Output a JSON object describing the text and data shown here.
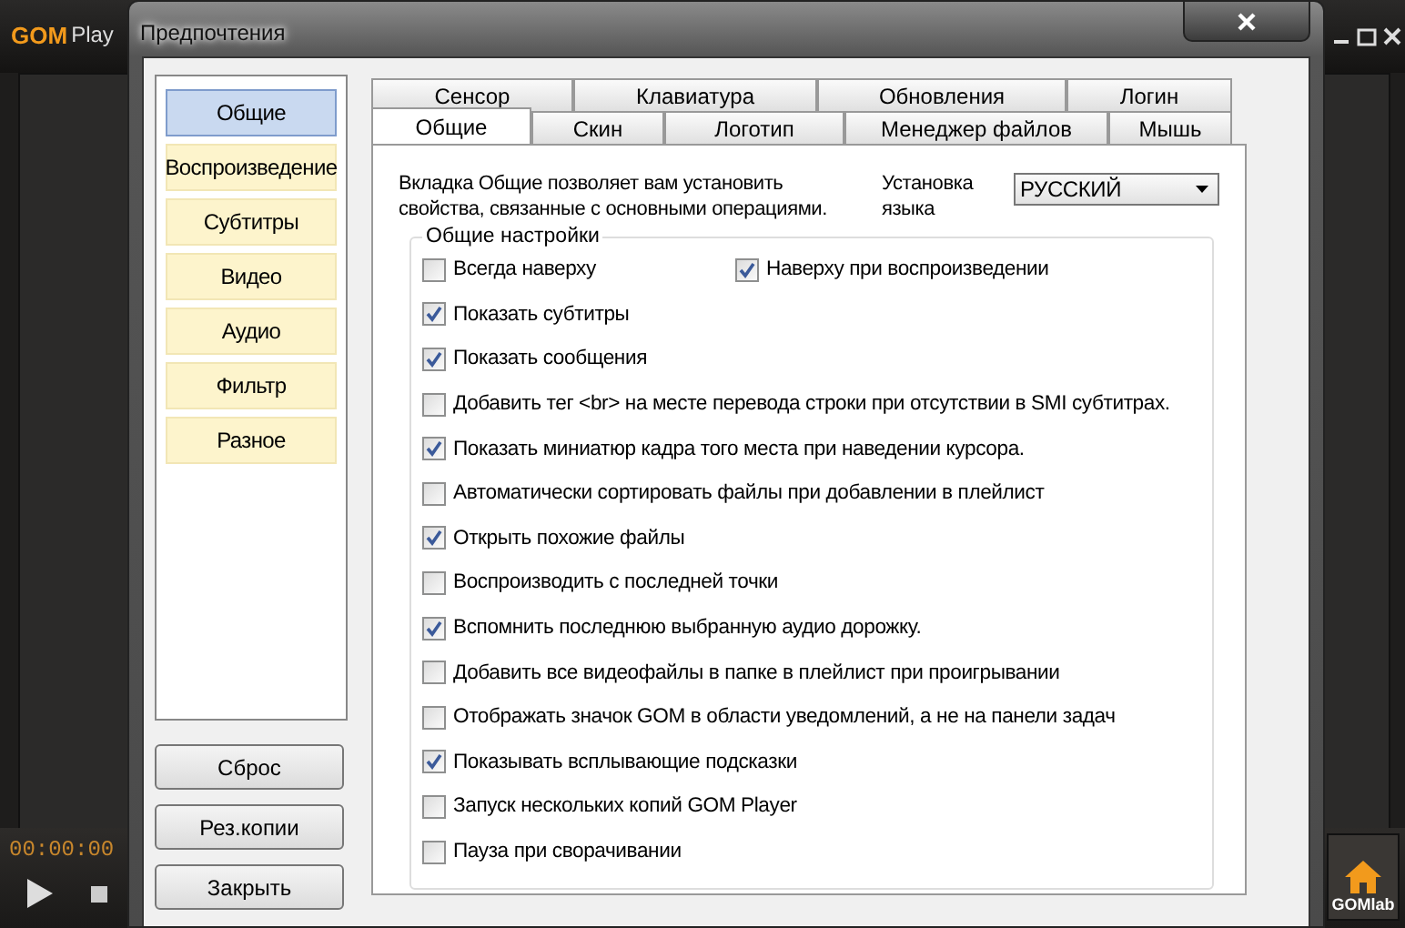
{
  "player": {
    "logo": "GOM",
    "title": "Play",
    "time": "00:00:00",
    "gomlab": "GOMlab"
  },
  "dialog": {
    "title": "Предпочтения",
    "categories": [
      {
        "label": "Общие",
        "selected": true
      },
      {
        "label": "Воспроизведение",
        "selected": false
      },
      {
        "label": "Субтитры",
        "selected": false
      },
      {
        "label": "Видео",
        "selected": false
      },
      {
        "label": "Аудио",
        "selected": false
      },
      {
        "label": "Фильтр",
        "selected": false
      },
      {
        "label": "Разное",
        "selected": false
      }
    ],
    "buttons": [
      "Сброс",
      "Рез.копии",
      "Закрыть"
    ],
    "tab_rows": [
      [
        {
          "label": "Сенсор",
          "selected": false
        },
        {
          "label": "Клавиатура",
          "selected": false
        },
        {
          "label": "Обновления",
          "selected": false
        },
        {
          "label": "Логин",
          "selected": false
        }
      ],
      [
        {
          "label": "Общие",
          "selected": true
        },
        {
          "label": "Скин",
          "selected": false
        },
        {
          "label": "Логотип",
          "selected": false
        },
        {
          "label": "Менеджер файлов",
          "selected": false
        },
        {
          "label": "Мышь",
          "selected": false
        }
      ]
    ],
    "description": "Вкладка Общие позволяет вам установить свойства, связанные с основными операциями.",
    "language": {
      "label": "Установка языка",
      "value": "РУССКИЙ"
    },
    "group_title": "Общие настройки",
    "option_rows": [
      [
        {
          "label": "Всегда наверху",
          "checked": false
        },
        {
          "label": "Наверху при воспроизведении",
          "checked": true
        }
      ],
      [
        {
          "label": "Показать субтитры",
          "checked": true
        }
      ],
      [
        {
          "label": "Показать сообщения",
          "checked": true
        }
      ],
      [
        {
          "label": "Добавить тег <br> на месте перевода строки при отсутствии в SMI субтитрах.",
          "checked": false
        }
      ],
      [
        {
          "label": "Показать миниатюр кадра того места при наведении курсора.",
          "checked": true
        }
      ],
      [
        {
          "label": "Автоматически сортировать файлы при добавлении в плейлист",
          "checked": false
        }
      ],
      [
        {
          "label": "Открыть похожие файлы",
          "checked": true
        }
      ],
      [
        {
          "label": "Воспроизводить с последней точки",
          "checked": false
        }
      ],
      [
        {
          "label": "Вспомнить последнюю выбранную аудио дорожку.",
          "checked": true
        }
      ],
      [
        {
          "label": "Добавить все видеофайлы в папке в плейлист при проигрывании",
          "checked": false
        }
      ],
      [
        {
          "label": "Отображать значок GOM в области уведомлений, а не на панели задач",
          "checked": false
        }
      ],
      [
        {
          "label": "Показывать всплывающие подсказки",
          "checked": true
        }
      ],
      [
        {
          "label": "Запуск нескольких копий GOM Player",
          "checked": false
        }
      ],
      [
        {
          "label": "Пауза при сворачивании",
          "checked": false
        }
      ]
    ]
  }
}
